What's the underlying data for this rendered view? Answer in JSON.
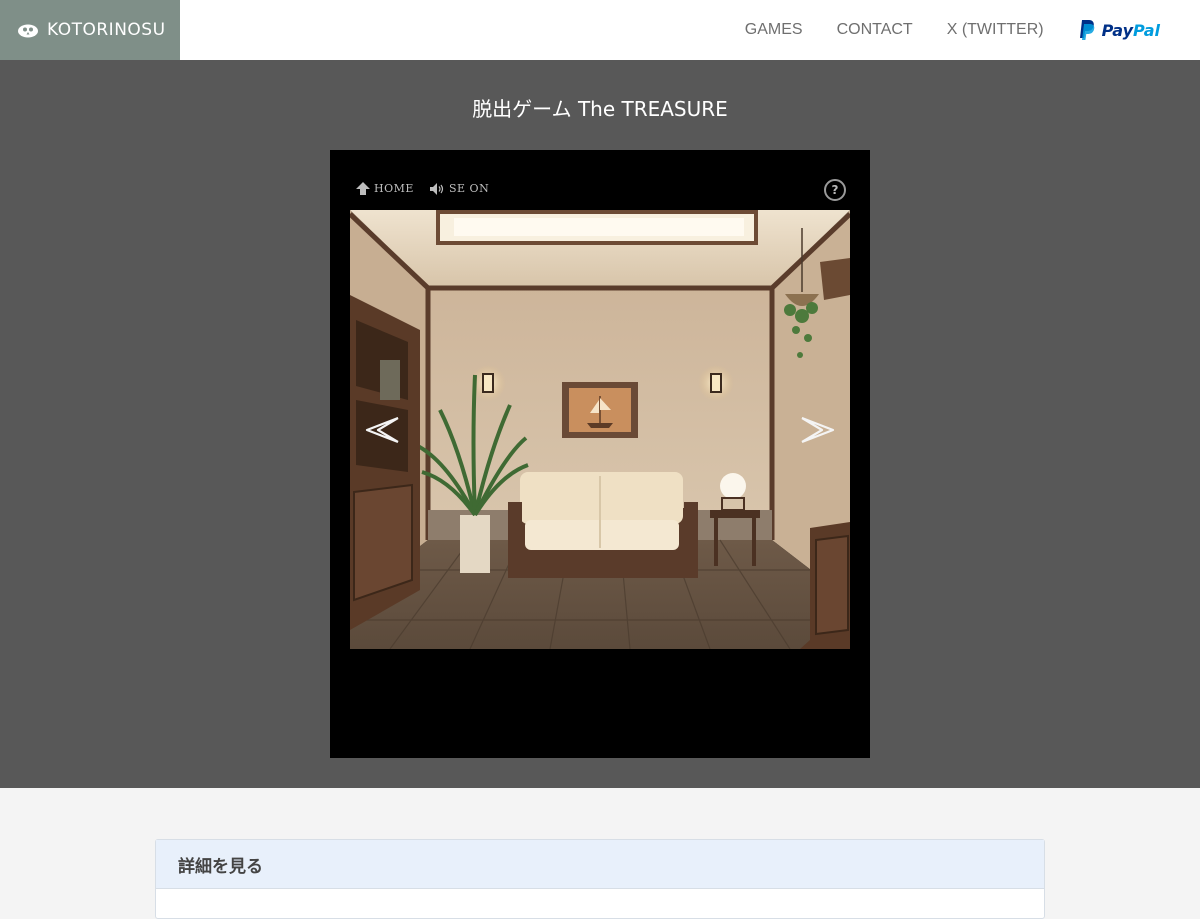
{
  "header": {
    "brand": "KOTORINOSU",
    "nav": [
      "GAMES",
      "CONTACT",
      "X (TWITTER)"
    ],
    "paypal": {
      "part1": "Pay",
      "part2": "Pal"
    }
  },
  "game": {
    "title": "脱出ゲーム The TREASURE",
    "toolbar": {
      "home_label": "HOME",
      "se_label": "SE ON",
      "help_label": "?"
    }
  },
  "details": {
    "title": "詳細を見る"
  },
  "colors": {
    "brand_bg": "#7f8f88",
    "stage_bg": "#585858",
    "frame_bg": "#000000",
    "details_head_bg": "#e8f0fb"
  }
}
